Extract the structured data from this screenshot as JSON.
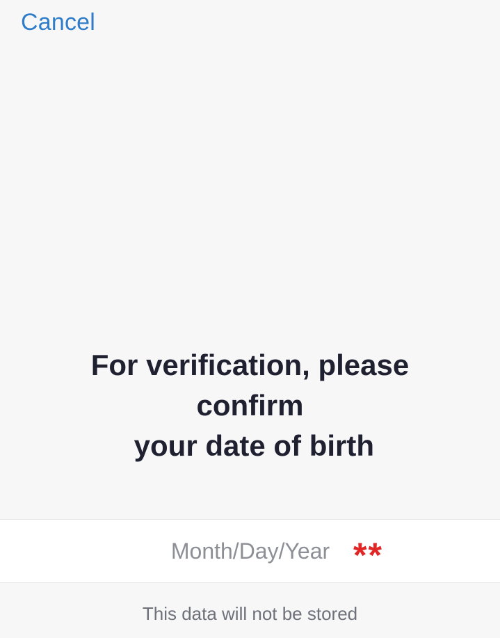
{
  "header": {
    "cancel_label": "Cancel"
  },
  "prompt": {
    "lines": [
      "For verification, please",
      "confirm",
      " your date of birth"
    ]
  },
  "date_field": {
    "placeholder": "Month/Day/Year",
    "value": "",
    "required_marks": "**"
  },
  "footer": {
    "notice": "This data will not be stored"
  },
  "colors": {
    "accent": "#2f7cc9",
    "heading": "#1f2131",
    "required": "#e12626",
    "background": "#f7f7f8",
    "field_background": "#ffffff"
  }
}
